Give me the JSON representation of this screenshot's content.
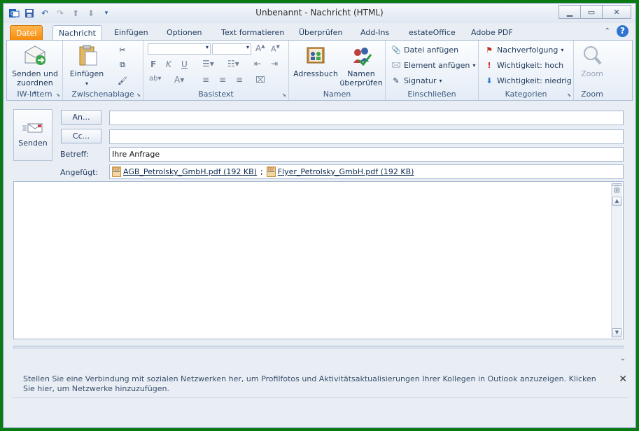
{
  "window": {
    "title": "Unbenannt - Nachricht (HTML)"
  },
  "tabs": [
    {
      "label": "Datei"
    },
    {
      "label": "Nachricht"
    },
    {
      "label": "Einfügen"
    },
    {
      "label": "Optionen"
    },
    {
      "label": "Text formatieren"
    },
    {
      "label": "Überprüfen"
    },
    {
      "label": "Add-Ins"
    },
    {
      "label": "estateOffice"
    },
    {
      "label": "Adobe PDF"
    }
  ],
  "ribbon": {
    "iw": {
      "button": "Senden und\nzuordnen",
      "label": "IW-Intern"
    },
    "clipboard": {
      "paste": "Einfügen",
      "label": "Zwischenablage"
    },
    "basictext": {
      "label": "Basistext",
      "bold": "F",
      "italic": "K",
      "underline": "U"
    },
    "names": {
      "addressbook": "Adressbuch",
      "check": "Namen\nüberprüfen",
      "label": "Namen"
    },
    "include": {
      "attach_file": "Datei anfügen",
      "attach_item": "Element anfügen",
      "signature": "Signatur",
      "label": "Einschließen"
    },
    "categories": {
      "followup": "Nachverfolgung",
      "high": "Wichtigkeit: hoch",
      "low": "Wichtigkeit: niedrig",
      "label": "Kategorien"
    },
    "zoom": {
      "button": "Zoom",
      "label": "Zoom"
    }
  },
  "compose": {
    "send": "Senden",
    "to_btn": "An...",
    "cc_btn": "Cc...",
    "subject_label": "Betreff:",
    "subject": "Ihre Anfrage",
    "attached_label": "Angefügt:",
    "attachments": [
      {
        "name": "AGB_Petrolsky_GmbH.pdf (192 KB)"
      },
      {
        "name": "Flyer_Petrolsky_GmbH.pdf (192 KB)"
      }
    ],
    "separator": ";"
  },
  "social_bar": {
    "text": "Stellen Sie eine Verbindung mit sozialen Netzwerken her, um Profilfotos und Aktivitätsaktualisierungen Ihrer Kollegen in Outlook anzuzeigen. Klicken Sie hier, um Netzwerke hinzuzufügen."
  },
  "colors": {
    "file_tab": "#f48a0b",
    "accent": "#2f74d0",
    "frame": "#0a7a12"
  }
}
